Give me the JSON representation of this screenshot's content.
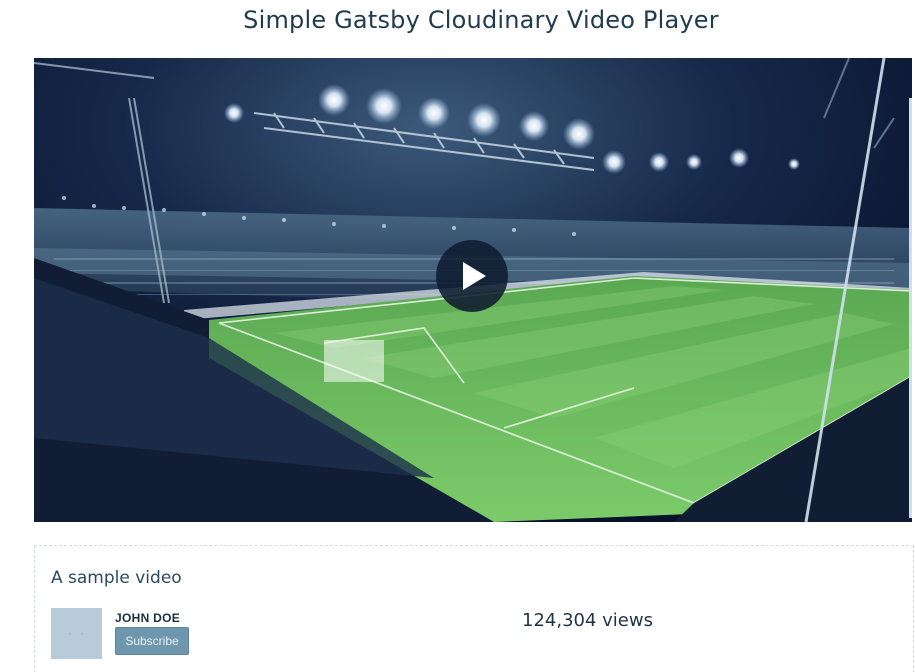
{
  "page": {
    "title": "Simple Gatsby Cloudinary Video Player"
  },
  "player": {
    "play_icon": "play-icon",
    "poster_description": "stadium-football-match"
  },
  "video": {
    "title": "A sample video",
    "channel_name": "JOHN DOE",
    "subscribe_label": "Subscribe",
    "views": "124,304 views"
  },
  "colors": {
    "title_text": "#1f3b4d",
    "subscribe_bg": "#6e96ad",
    "avatar_bg": "#b8cbd8",
    "pitch": "#6dbd5e"
  }
}
